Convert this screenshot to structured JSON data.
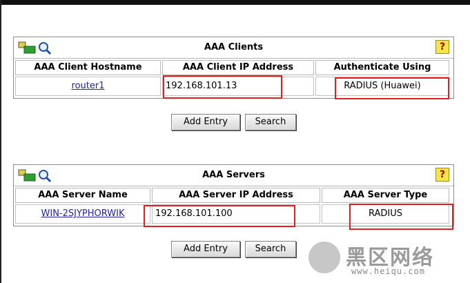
{
  "clients_panel": {
    "title": "AAA Clients",
    "headers": [
      "AAA Client Hostname",
      "AAA Client IP Address",
      "Authenticate Using"
    ],
    "row": {
      "hostname": "router1",
      "ip": "192.168.101.13",
      "auth": "RADIUS (Huawei)"
    },
    "add_label": "Add Entry",
    "search_label": "Search",
    "help_glyph": "?"
  },
  "servers_panel": {
    "title": "AAA Servers",
    "headers": [
      "AAA Server Name",
      "AAA Server IP Address",
      "AAA Server Type"
    ],
    "row": {
      "name": "WIN-2SJYPHORWIK",
      "ip": "192.168.101.100",
      "type": "RADIUS"
    },
    "add_label": "Add Entry",
    "search_label": "Search",
    "help_glyph": "?"
  },
  "watermark": {
    "text": "黑区网络",
    "url": "www.heiqu.com"
  },
  "icons": {
    "header_logo": "network-search-icon",
    "help": "help-icon"
  },
  "colors": {
    "highlight": "#e02020",
    "link": "#2222aa",
    "help_bg": "#f7e54a"
  }
}
